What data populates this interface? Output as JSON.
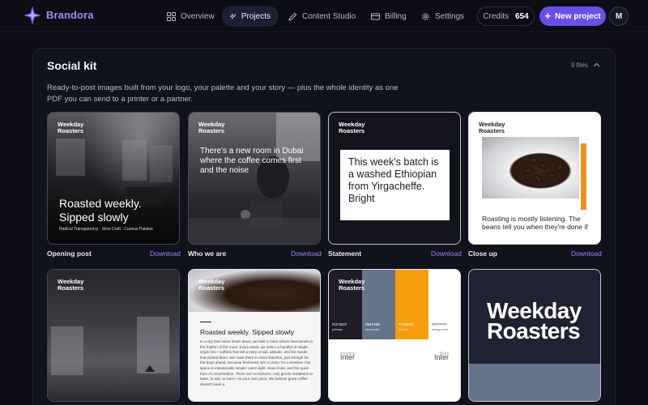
{
  "app": {
    "brand": "Brandora"
  },
  "nav": {
    "items": [
      {
        "label": "Overview",
        "icon": "grid-icon"
      },
      {
        "label": "Projects",
        "icon": "sparkle-icon",
        "active": true
      },
      {
        "label": "Content Studio",
        "icon": "pen-icon"
      },
      {
        "label": "Billing",
        "icon": "card-icon"
      },
      {
        "label": "Settings",
        "icon": "gear-icon"
      }
    ],
    "credits_label": "Credits",
    "credits_value": "654",
    "new_project": "New project",
    "avatar_initial": "M"
  },
  "section": {
    "title": "Social kit",
    "file_count": "9 files",
    "description": "Ready-to-post images built from your logo, your palette and your story — plus the whole identity as one PDF you can send to a printer or a partner.",
    "download_label": "Download",
    "logo_text_line1": "Weekday",
    "logo_text_line2": "Roasters"
  },
  "tiles": [
    {
      "caption": "Opening post",
      "headline": "Roasted weekly. Sipped slowly",
      "tagline": "Radical Transparency · Slow Craft · Curious Palates"
    },
    {
      "caption": "Who we are",
      "headline": "There's a new room in Dubai where the coffee comes first and the noise"
    },
    {
      "caption": "Statement",
      "headline": "This week's batch is a washed Ethiopian from Yirgacheffe. Bright"
    },
    {
      "caption": "Close up",
      "headline": "Roasting is mostly listening. The beans tell you when they're done if"
    },
    {
      "caption": ""
    },
    {
      "headline": "Roasted weekly. Sipped slowly",
      "body": "In a city that never slows down, we built a room where time bends to the rhythm of the roast. Every week, we select a handful of single-origin lots—coffees that tell a story of soil, altitude, and the hands that picked them. We roast them in micro-batches, just enough for the days ahead, because freshness isn't a claim; it's a timeline. Our space is intentionally simple: warm light, clean lines, and the quiet hum of conversation. There are no lectures, only gentle invitations to taste, to ask, to learn—at your own pace. We believe great coffee doesn't need a"
    },
    {
      "swatches": [
        {
          "hex": "#1F1B27",
          "name": "primary",
          "color": "#1f1b27"
        },
        {
          "hex": "#64748B",
          "name": "secondary",
          "color": "#64748b"
        },
        {
          "hex": "#F59E0B",
          "name": "accent",
          "color": "#f59e0b"
        },
        {
          "hex": "#FFFFFF",
          "name": "background",
          "color": "#ffffff"
        }
      ],
      "font_heading_label": "Heading",
      "font_body_label": "Body",
      "font_heading": "Inter",
      "font_body": "Inter"
    },
    {
      "wordmark_line1": "Weekday",
      "wordmark_line2": "Roasters"
    }
  ],
  "colors": {
    "accent": "#6a4ee6",
    "download_link": "#9c86f5",
    "brand_text": "#a58cf2"
  }
}
